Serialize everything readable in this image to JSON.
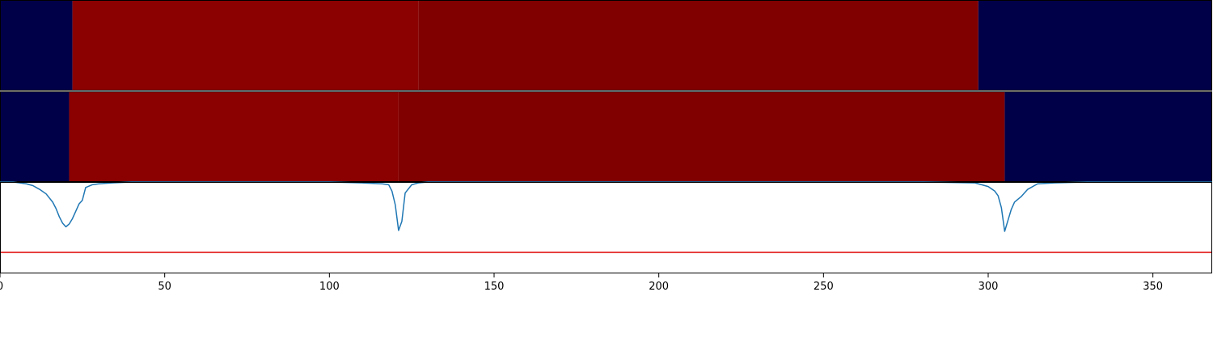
{
  "chart_data": [
    {
      "type": "heatmap",
      "title": "",
      "xlim": [
        0,
        368
      ],
      "colors": {
        "low": "#000049",
        "high": "#8b0000",
        "high_alt": "#800000"
      },
      "segments": [
        {
          "x_start": 0,
          "x_end": 22,
          "level": "low"
        },
        {
          "x_start": 22,
          "x_end": 127,
          "level": "high"
        },
        {
          "x_start": 127,
          "x_end": 297,
          "level": "high_alt"
        },
        {
          "x_start": 297,
          "x_end": 368,
          "level": "low"
        }
      ]
    },
    {
      "type": "heatmap",
      "title": "",
      "xlim": [
        0,
        368
      ],
      "colors": {
        "low": "#000049",
        "high": "#8b0000",
        "high_alt": "#800000"
      },
      "segments": [
        {
          "x_start": 0,
          "x_end": 21,
          "level": "low"
        },
        {
          "x_start": 21,
          "x_end": 121,
          "level": "high"
        },
        {
          "x_start": 121,
          "x_end": 305,
          "level": "high_alt"
        },
        {
          "x_start": 305,
          "x_end": 368,
          "level": "low"
        }
      ]
    },
    {
      "type": "line",
      "title": "",
      "xlabel": "",
      "ylabel": "",
      "xlim": [
        0,
        368
      ],
      "ylim": [
        -1.0,
        0.0
      ],
      "xticks": [
        0,
        50,
        100,
        150,
        200,
        250,
        300,
        350
      ],
      "xtick_labels": [
        "0",
        "50",
        "100",
        "150",
        "200",
        "250",
        "300",
        "350"
      ],
      "series": [
        {
          "color": "#1f77b4",
          "x": [
            0,
            4,
            8,
            10,
            12,
            14,
            16,
            17,
            18,
            19,
            20,
            21,
            22,
            23,
            24,
            25,
            26,
            28,
            30,
            34,
            40,
            60,
            80,
            100,
            110,
            116,
            118,
            119,
            120,
            121,
            122,
            123,
            125,
            127,
            130,
            140,
            160,
            200,
            240,
            280,
            296,
            300,
            302,
            303,
            304,
            305,
            306,
            307,
            308,
            310,
            312,
            315,
            320,
            330,
            368
          ],
          "y": [
            0.0,
            0.0,
            -0.02,
            -0.04,
            -0.08,
            -0.13,
            -0.22,
            -0.29,
            -0.38,
            -0.45,
            -0.49,
            -0.46,
            -0.4,
            -0.32,
            -0.24,
            -0.2,
            -0.06,
            -0.03,
            -0.02,
            -0.01,
            0.0,
            0.0,
            0.0,
            0.0,
            -0.01,
            -0.02,
            -0.03,
            -0.1,
            -0.25,
            -0.53,
            -0.43,
            -0.12,
            -0.03,
            -0.01,
            0.0,
            0.0,
            0.0,
            0.0,
            0.0,
            0.0,
            -0.01,
            -0.05,
            -0.1,
            -0.15,
            -0.28,
            -0.54,
            -0.42,
            -0.3,
            -0.22,
            -0.16,
            -0.08,
            -0.02,
            -0.01,
            0.0,
            0.0
          ]
        }
      ],
      "hlines": [
        {
          "y": -0.77,
          "color": "#e00000"
        }
      ]
    }
  ]
}
